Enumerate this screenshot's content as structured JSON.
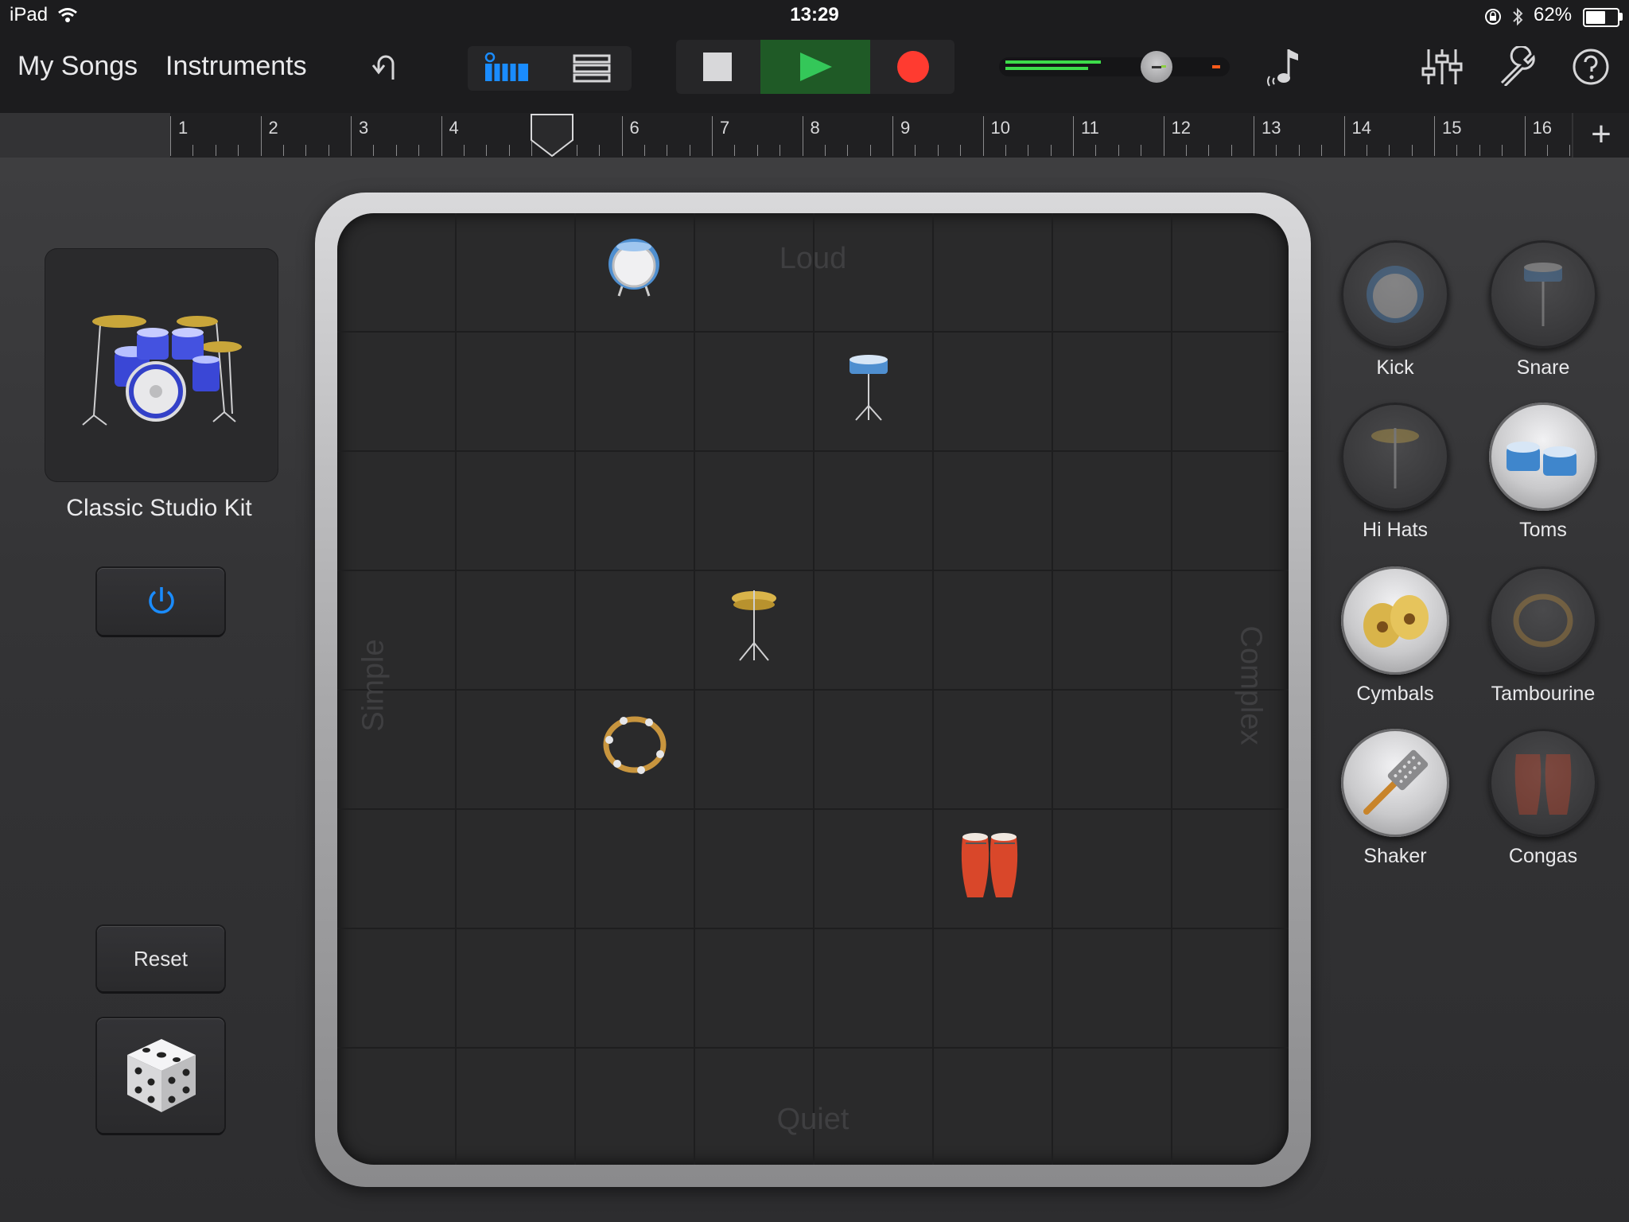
{
  "status": {
    "device": "iPad",
    "time": "13:29",
    "battery": "62%"
  },
  "nav": {
    "my_songs": "My Songs",
    "instruments": "Instruments"
  },
  "colors": {
    "accent_blue": "#1a8cff",
    "play_green": "#34c759",
    "record_red": "#ff3b30",
    "level_green": "#3ddc4a"
  },
  "ruler": {
    "bars": [
      "1",
      "2",
      "3",
      "4",
      "5",
      "6",
      "7",
      "8",
      "9",
      "10",
      "11",
      "12",
      "13",
      "14",
      "15",
      "16"
    ],
    "playhead_bar": "5"
  },
  "kit": {
    "name": "Classic Studio Kit"
  },
  "buttons": {
    "reset": "Reset"
  },
  "pad": {
    "top": "Loud",
    "bottom": "Quiet",
    "left": "Simple",
    "right": "Complex"
  },
  "instruments": [
    {
      "label": "Kick",
      "enabled": false,
      "icon": "kick-drum-icon"
    },
    {
      "label": "Snare",
      "enabled": false,
      "icon": "snare-drum-icon"
    },
    {
      "label": "Hi Hats",
      "enabled": false,
      "icon": "hihat-icon"
    },
    {
      "label": "Toms",
      "enabled": true,
      "icon": "toms-icon"
    },
    {
      "label": "Cymbals",
      "enabled": true,
      "icon": "cymbals-icon"
    },
    {
      "label": "Tambourine",
      "enabled": false,
      "icon": "tambourine-icon"
    },
    {
      "label": "Shaker",
      "enabled": true,
      "icon": "shaker-icon"
    },
    {
      "label": "Congas",
      "enabled": false,
      "icon": "congas-icon"
    }
  ]
}
